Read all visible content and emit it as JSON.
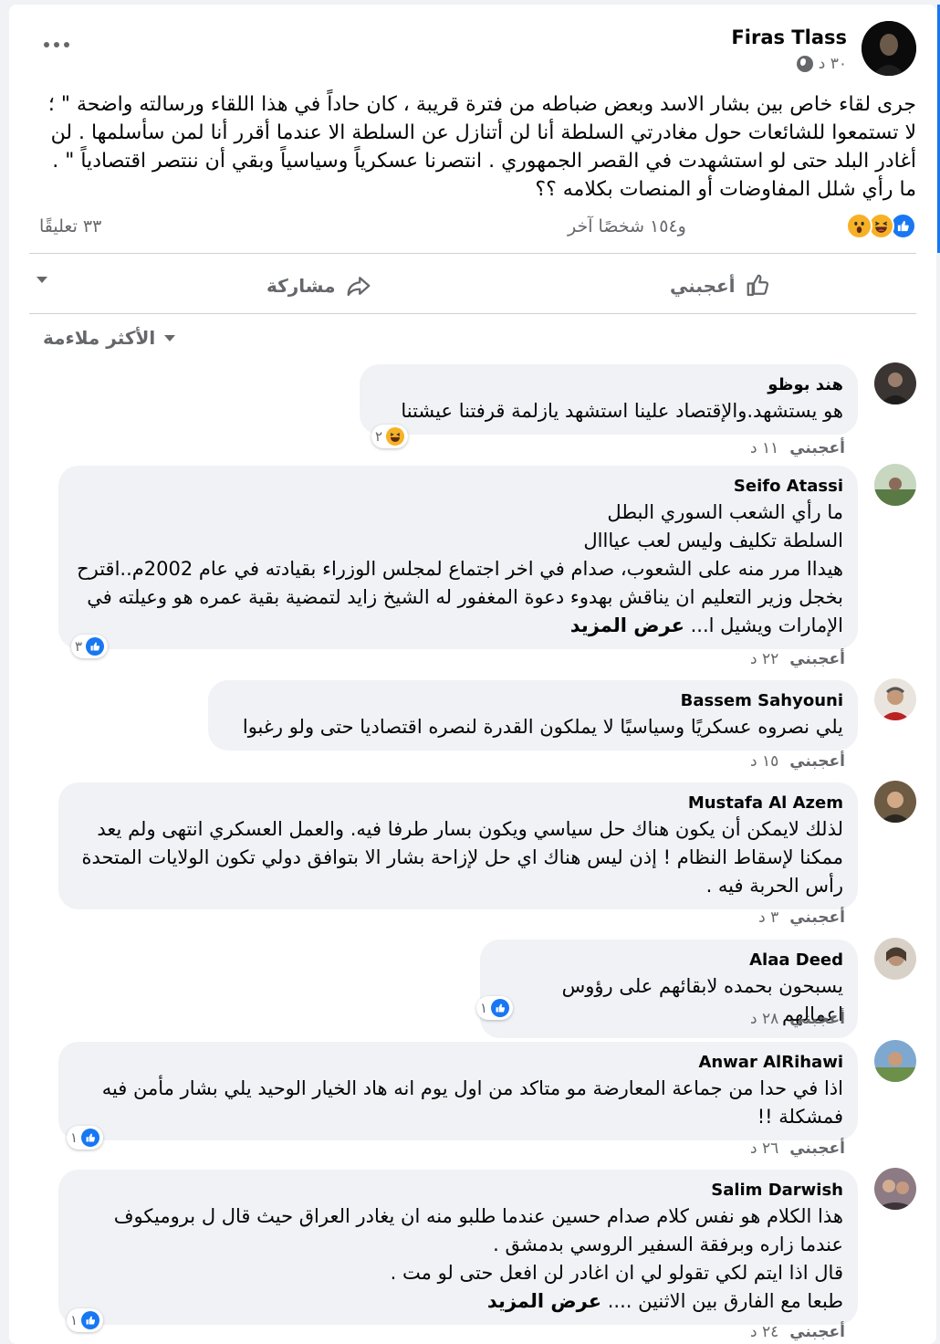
{
  "post": {
    "author": "Firas Tlass",
    "time": "٣٠ د",
    "text": "جرى لقاء خاص بين بشار الاسد وبعض ضباطه من فترة قريبة ، كان حاداً في هذا اللقاء ورسالته واضحة \" ؛ لا تستمعوا للشائعات حول مغادرتي السلطة أنا لن أتنازل عن السلطة الا عندما أقرر أنا لمن سأسلمها . لن أغادر البلد حتى لو استشهدت في القصر الجمهوري . انتصرنا عسكرياً وسياسياً وبقي أن ننتصر اقتصادياً \" .\nما رأي شلل المفاوضات أو المنصات  بكلامه ؟؟",
    "reaction_types": [
      "like",
      "haha",
      "wow"
    ],
    "reactions_others": "و١٥٤ شخصًا آخر",
    "comments_count": "٣٣ تعليقًا",
    "like_label": "أعجبني",
    "share_label": "مشاركة",
    "sort_label": "الأكثر ملاءمة"
  },
  "comments": [
    {
      "name": "هند بوظو",
      "text": "هو يستشهد.والإقتصاد علينا استشهد يازلمة قرفتنا عيشتنا",
      "more": "",
      "reaction": "haha",
      "count": "٢",
      "like": "أعجبني",
      "time": "١١ د"
    },
    {
      "name": "Seifo Atassi",
      "text": "ما رأي الشعب السوري البطل\nالسلطة تكليف وليس لعب عيااال\nهيداا مرر منه على الشعوب، صدام في اخر اجتماع لمجلس الوزراء بقيادته في عام 2002م..اقترح بخجل وزير التعليم ان يناقش بهدوء دعوة المغفور له الشيخ زايد لتمضية بقية عمره هو وعيلته في الإمارات ويشيل ا...",
      "more": "عرض المزيد",
      "reaction": "like",
      "count": "٣",
      "like": "أعجبني",
      "time": "٢٢ د"
    },
    {
      "name": "Bassem Sahyouni",
      "text": "يلي نصروه عسكريًا وسياسيًا لا يملكون القدرة لنصره اقتصاديا حتى ولو رغبوا",
      "more": "",
      "reaction": "",
      "count": "",
      "like": "أعجبني",
      "time": "١٥ د"
    },
    {
      "name": "Mustafa Al Azem",
      "text": "لذلك لايمكن أن يكون هناك حل سياسي ويكون بسار طرفا فيه. والعمل العسكري انتهى ولم يعد ممكنا لإسقاط النظام ! إذن ليس هناك اي حل لإزاحة بشار الا بتوافق دولي تكون الولايات المتحدة رأس الحربة فيه .",
      "more": "",
      "reaction": "",
      "count": "",
      "like": "أعجبني",
      "time": "٣ د"
    },
    {
      "name": "Alaa Deed",
      "text": "يسبحون بحمده لابقائهم على رؤوس اعمالهم",
      "more": "",
      "reaction": "like",
      "count": "١",
      "like": "أعجبني",
      "time": "٢٨ د"
    },
    {
      "name": "Anwar AlRihawi",
      "text": "اذا في حدا من جماعة المعارضة مو متاكد من اول يوم انه هاد الخيار الوحيد يلي بشار مأمن فيه فمشكلة !!",
      "more": "",
      "reaction": "like",
      "count": "١",
      "like": "أعجبني",
      "time": "٢٦ د"
    },
    {
      "name": "Salim Darwish",
      "text": "هذا الكلام هو نفس كلام صدام حسين عندما طلبو منه ان يغادر العراق حيث قال ل بروميكوف عندما زاره وبرفقة السفير الروسي بدمشق .\nقال اذا ايتم لكي تقولو لي ان اغادر لن افعل حتى لو مت .\nطبعا مع الفارق بين الاثنين ....",
      "more": "عرض المزيد",
      "reaction": "like",
      "count": "١",
      "like": "أعجبني",
      "time": "٢٤ د"
    }
  ],
  "colors": {
    "accent": "#1877f2",
    "bubble": "#f0f2f5",
    "muted": "#65676b"
  }
}
